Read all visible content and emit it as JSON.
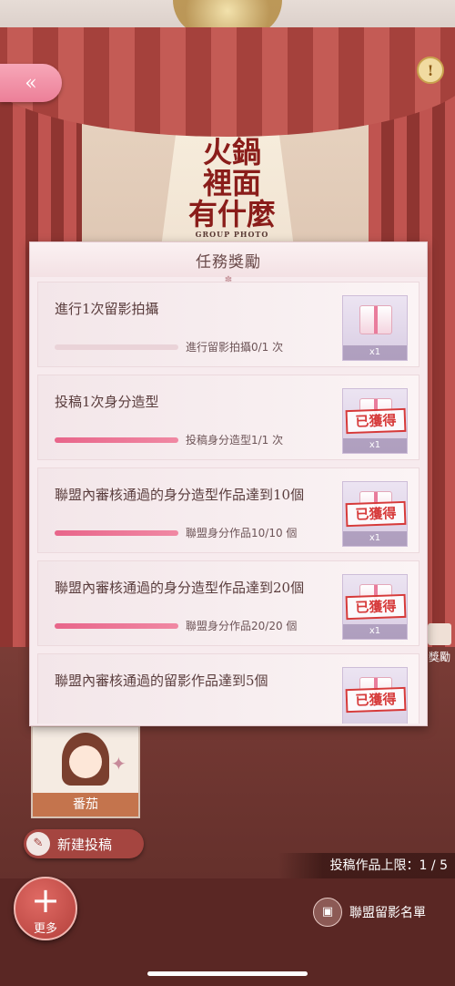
{
  "header": {
    "back_icon": "«",
    "info_icon": "!"
  },
  "logo": {
    "line1": "火鍋",
    "line2": "裡面",
    "line3": "有什麼",
    "sub": "GROUP PHOTO"
  },
  "panel": {
    "title": "任務獎勵",
    "tasks": [
      {
        "title": "進行1次留影拍攝",
        "progress_text": "進行留影拍攝0/1 次",
        "progress": 0.0,
        "reward_count": "x1",
        "obtained": false
      },
      {
        "title": "投稿1次身分造型",
        "progress_text": "投稿身分造型1/1 次",
        "progress": 1.0,
        "reward_count": "x1",
        "obtained": true,
        "obtained_label": "已獲得"
      },
      {
        "title": "聯盟內審核通過的身分造型作品達到10個",
        "progress_text": "聯盟身分作品10/10 個",
        "progress": 1.0,
        "reward_count": "x1",
        "obtained": true,
        "obtained_label": "已獲得"
      },
      {
        "title": "聯盟內審核通過的身分造型作品達到20個",
        "progress_text": "聯盟身分作品20/20 個",
        "progress": 1.0,
        "reward_count": "x1",
        "obtained": true,
        "obtained_label": "已獲得"
      },
      {
        "title": "聯盟內審核通過的留影作品達到5個",
        "progress_text": "",
        "progress": 1.0,
        "reward_count": "",
        "obtained": true,
        "obtained_label": "已獲得"
      }
    ]
  },
  "side_reward": {
    "label": "獎勵"
  },
  "card": {
    "name": "番茄"
  },
  "new_post": {
    "label": "新建投稿"
  },
  "limit": {
    "text": "投稿作品上限：1 / 5"
  },
  "more": {
    "label": "更多"
  },
  "roster": {
    "label": "聯盟留影名單"
  }
}
